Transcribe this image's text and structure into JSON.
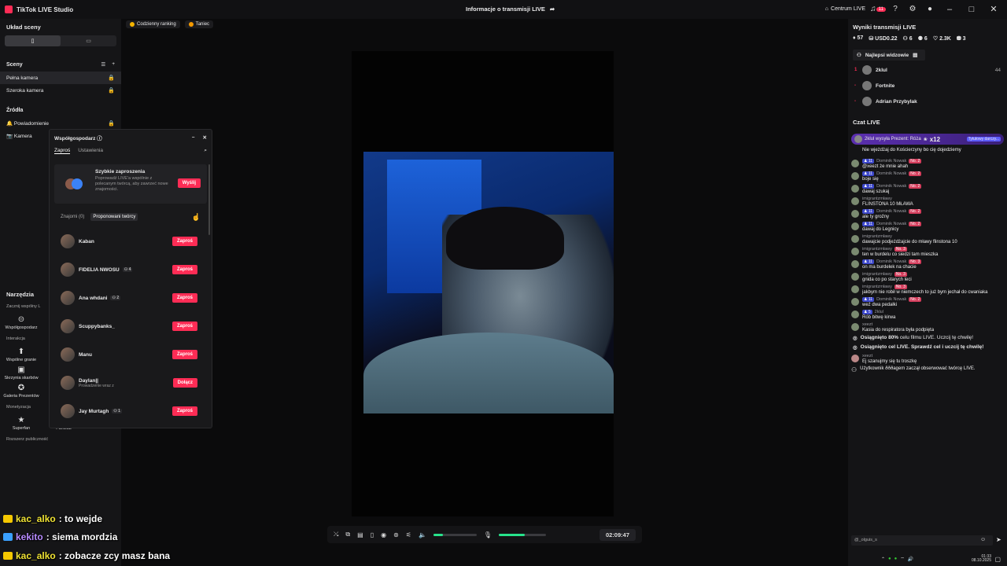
{
  "titlebar": {
    "app_name": "TikTok LIVE Studio",
    "center_title": "Informacje o transmisji LIVE",
    "centrum": "Centrum LIVE",
    "notif_count": "11"
  },
  "left": {
    "scene_layout": "Układ sceny",
    "scenes_title": "Sceny",
    "scenes": [
      "Pełna kamera",
      "Szeroka kamera"
    ],
    "sources_title": "Źródła",
    "sources": [
      "Powiadomienie",
      "Kamera"
    ],
    "tools_title": "Narzędzia",
    "tools_sub": "Zacznij wspólny L",
    "tool_cohost": "Współgospodarz",
    "interaction": "Interakcja",
    "tool_coplay": "Wspólne granie",
    "tool_chest": "Skrzynia skarbów",
    "tool_gallery": "Galeria Prezentów",
    "monetization": "Monetyzacja",
    "tool_superfan": "Superfan",
    "tool_fanclub": "Fanklub",
    "expand_audience": "Rozszerz publiczność"
  },
  "pills": [
    "Codzienny ranking",
    "Taniec"
  ],
  "modal": {
    "title": "Współgospodarz",
    "tab_invite": "Zaproś",
    "tab_settings": "Ustawienia",
    "quick_title": "Szybkie zaproszenia",
    "quick_desc": "Poprowadź LIVE'a wspólnie z polecanym twórcą, aby zawrzeć nowe znajomości.",
    "quick_btn": "Wyślij",
    "tab_friends": "Znajomi (0)",
    "tab_suggested": "Proponowani twórcy",
    "creators": [
      {
        "name": "Kaban",
        "count": "",
        "sub": "",
        "btn": "Zaproś"
      },
      {
        "name": "FIDELIA NWOSU",
        "count": "4",
        "sub": "",
        "btn": "Zaproś"
      },
      {
        "name": "Ana whdani",
        "count": "2",
        "sub": "",
        "btn": "Zaproś"
      },
      {
        "name": "Scuppybanks_",
        "count": "",
        "sub": "",
        "btn": "Zaproś"
      },
      {
        "name": "Manu",
        "count": "",
        "sub": "",
        "btn": "Zaproś"
      },
      {
        "name": "Daylan||",
        "count": "",
        "sub": "Prowadzenie wraz z",
        "btn": "Dołącz"
      },
      {
        "name": "Jay Murtagh",
        "count": "1",
        "sub": "",
        "btn": "Zaproś"
      }
    ]
  },
  "controls": {
    "timer": "02:09:47",
    "volume": 0.22,
    "mic": 0.55
  },
  "overlay": [
    {
      "name": "kac_alko",
      "text": ": to wejde"
    },
    {
      "name": "kekito",
      "text": ": siema mordzia"
    },
    {
      "name": "kac_alko",
      "text": ": zobacze zcy masz bana"
    }
  ],
  "right": {
    "results_title": "Wyniki transmisji LIVE",
    "stats": [
      "57",
      "USD0.22",
      "6",
      "6",
      "2.3K",
      "3"
    ],
    "top_viewers": "Najlepsi widzowie",
    "viewers": [
      {
        "rank": "1",
        "name": "2klul",
        "score": "44"
      },
      {
        "rank": "-",
        "name": "Fortnite",
        "score": ""
      },
      {
        "rank": "-",
        "name": "Adrian Przybylak",
        "score": ""
      }
    ],
    "chat_title": "Czat LIVE",
    "gift_text": "2klul wysyła Prezent: Róża",
    "gift_count": "x12",
    "gift_tag": "Tytułowy darczy...",
    "messages": [
      {
        "user": "",
        "lvl": "",
        "no": "",
        "text": "Nie wjeżdżaj do Kościerzyny bo cię dojedziemy"
      },
      {
        "user": "Dominik Nowak",
        "lvl": "11",
        "no": "No. 2",
        "text": "@xeezt że mnie ahah"
      },
      {
        "user": "Dominik Nowak",
        "lvl": "11",
        "no": "No. 2",
        "text": "boje się"
      },
      {
        "user": "Dominik Nowak",
        "lvl": "11",
        "no": "No. 2",
        "text": "dawaj szukaj"
      },
      {
        "user": "imigrantzmławy",
        "lvl": "",
        "no": "",
        "text": "FLINSTONA 10 MŁAWA"
      },
      {
        "user": "Dominik Nowak",
        "lvl": "11",
        "no": "No. 2",
        "text": "ale ty groźny"
      },
      {
        "user": "Dominik Nowak",
        "lvl": "11",
        "no": "No. 2",
        "text": "dawaj do Legnicy"
      },
      {
        "user": "imigrantzmławy",
        "lvl": "",
        "no": "",
        "text": "dawajcie podjeżdżajcie do mławy flinstona 10"
      },
      {
        "user": "imigrantzmławy",
        "lvl": "",
        "no": "No. 3",
        "text": "ten w burdelu co siedzi tam mieszka"
      },
      {
        "user": "Dominik Nowak",
        "lvl": "11",
        "no": "No. 3",
        "text": "on ma burdelek na chacie"
      },
      {
        "user": "imigrantzmławy",
        "lvl": "",
        "no": "No. 3",
        "text": "gnida co po starych leci"
      },
      {
        "user": "imigrantzmławy",
        "lvl": "",
        "no": "No. 3",
        "text": "jakbym nie robił w niemczech to już bym jechał do cwaniaka"
      },
      {
        "user": "Dominik Nowak",
        "lvl": "11",
        "no": "No. 2",
        "text": "weź dwa pedałki"
      },
      {
        "user": "2klul",
        "lvl": "5",
        "no": "",
        "text": "Rób bitwę kirwa"
      },
      {
        "user": "xeezt",
        "lvl": "",
        "no": "",
        "text": "Kasia do respiratora była podpięta"
      }
    ],
    "sys1_a": "Osiągnięto",
    "sys1_b": "80%",
    "sys1_c": "celu filmu LIVE. Uczcij tę chwilę!",
    "sys2": "Osiągnięto cel LIVE. Sprawdź cel i uczcij tę chwilę!",
    "last_msg_user": "xeezt",
    "last_msg": "Ej szanujmy się tu troszkę",
    "follow_msg": "Użytkownik ðððagem zaczął obserwować twórcę LIVE.",
    "input_value": "@_olguis_s"
  },
  "taskbar": {
    "time": "01:33",
    "date": "08.10.2025"
  },
  "colors": {
    "accent": "#fe2c55",
    "green": "#27e38b",
    "level": "#3d48c9"
  }
}
